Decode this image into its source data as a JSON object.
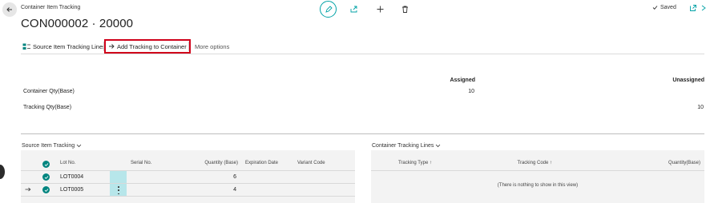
{
  "page": {
    "caption": "Container Item Tracking",
    "title": "CON000002 · 20000",
    "status": "Saved"
  },
  "toolbar_icons": [
    "edit-icon",
    "share-icon",
    "add-icon",
    "delete-icon"
  ],
  "actions": {
    "source_lines": "Source Item Tracking Lines",
    "add_tracking": "Add Tracking to Container",
    "more": "More options"
  },
  "header": {
    "assigned_label": "Assigned",
    "unassigned_label": "Unassigned",
    "rows": [
      {
        "label": "Container Qty(Base)",
        "assigned": "10",
        "unassigned": ""
      },
      {
        "label": "Tracking Qty(Base)",
        "assigned": "",
        "unassigned": "10"
      }
    ]
  },
  "source_tracking": {
    "title": "Source Item Tracking",
    "columns": {
      "lot": "Lot No.",
      "serial": "Serial No.",
      "qty": "Quantity (Base)",
      "exp": "Expiration Date",
      "variant": "Variant Code"
    },
    "rows": [
      {
        "lot": "LOT0004",
        "serial": "",
        "qty": "6",
        "exp": "",
        "variant": ""
      },
      {
        "lot": "LOT0005",
        "serial": "",
        "qty": "4",
        "exp": "",
        "variant": ""
      }
    ]
  },
  "container_tracking": {
    "title": "Container Tracking Lines",
    "columns": {
      "type": "Tracking Type ↑",
      "code": "Tracking Code ↑",
      "qty": "Quantity(Base)"
    },
    "empty": "(There is nothing to show in this view)"
  },
  "colors": {
    "accent": "#00a2a6",
    "check": "#00857f",
    "highlight_border": "#d0021b",
    "selected_cell": "#b7e6ea"
  }
}
